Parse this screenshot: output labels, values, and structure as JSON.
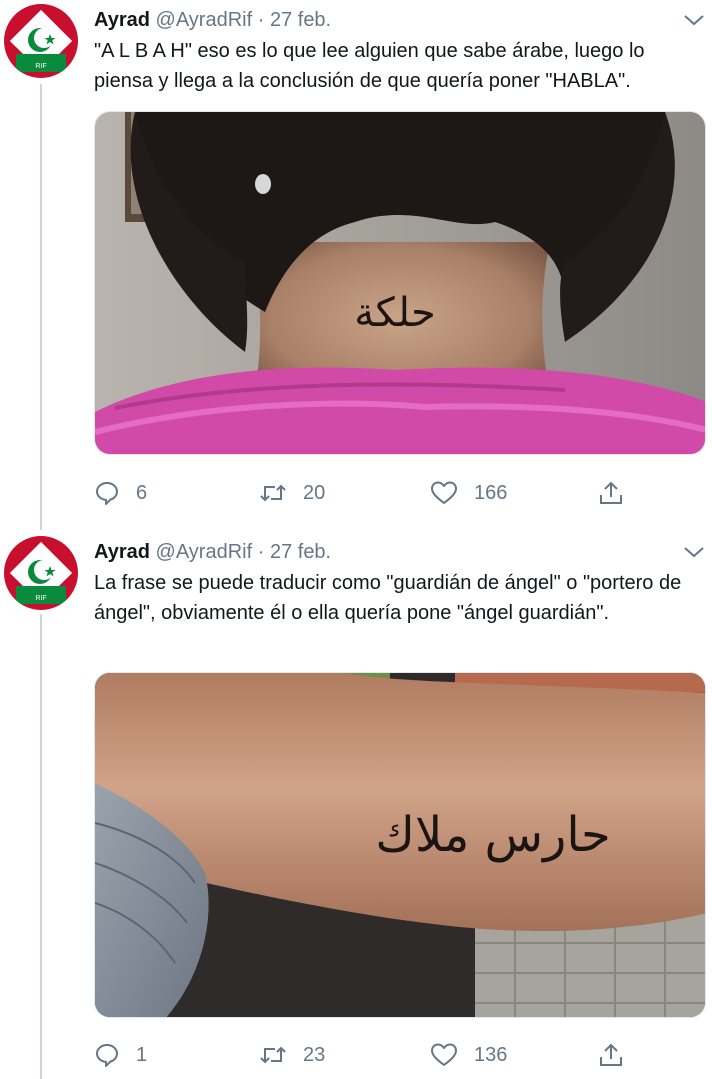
{
  "tweets": [
    {
      "author_name": "Ayrad",
      "handle": "@AyradRif",
      "separator": "·",
      "date": "27 feb.",
      "text": "\"A L B A H\" eso es lo que lee alguien que sabe árabe, luego lo piensa y llega a la conclusión de que quería poner \"HABLA\".",
      "avatar_label": "RIF",
      "photo": {
        "tattoo_text": "حلكة",
        "subject": "neck-tattoo"
      },
      "replies": "6",
      "retweets": "20",
      "likes": "166"
    },
    {
      "author_name": "Ayrad",
      "handle": "@AyradRif",
      "separator": "·",
      "date": "27 feb.",
      "text": "La frase se puede traducir como \"guardián de ángel\" o \"portero de ángel\", obviamente él o ella quería pone \"ángel guardián\".",
      "avatar_label": "RIF",
      "photo": {
        "tattoo_text": "حارس ملاك",
        "subject": "arm-tattoo"
      },
      "replies": "1",
      "retweets": "23",
      "likes": "136"
    }
  ],
  "icons": {
    "reply": "speech-bubble-icon",
    "retweet": "retweet-icon",
    "like": "heart-icon",
    "share": "share-upload-icon",
    "menu": "chevron-down-icon"
  },
  "colors": {
    "text": "#14171a",
    "muted": "#657786",
    "thread_line": "#ccd6dd",
    "flag_red": "#c8102e",
    "flag_green": "#0a8a3c"
  }
}
